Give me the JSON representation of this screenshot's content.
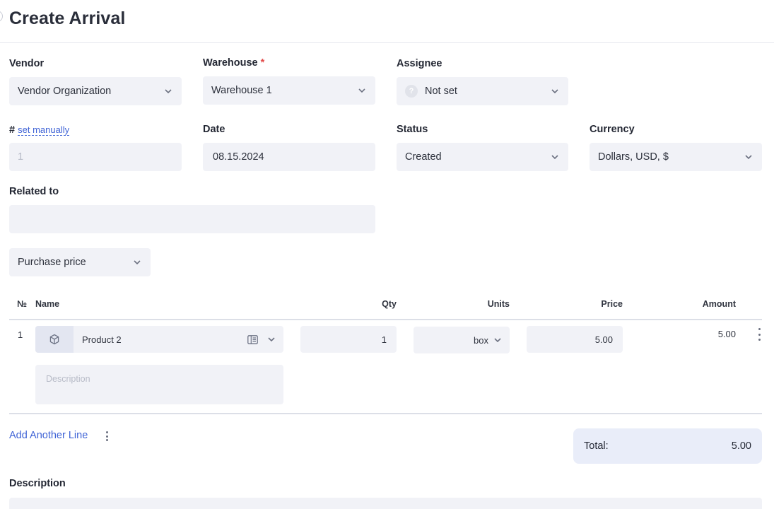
{
  "header": {
    "title": "Create Arrival"
  },
  "vendor": {
    "label": "Vendor",
    "value": "Vendor Organization"
  },
  "warehouse": {
    "label": "Warehouse",
    "required_mark": "*",
    "value": "Warehouse 1"
  },
  "assignee": {
    "label": "Assignee",
    "icon_text": "?",
    "value": "Not set"
  },
  "number": {
    "label": "#",
    "set_manually": "set manually",
    "value": "1"
  },
  "date": {
    "label": "Date",
    "value": "08.15.2024"
  },
  "status": {
    "label": "Status",
    "value": "Created"
  },
  "currency": {
    "label": "Currency",
    "value": "Dollars, USD, $"
  },
  "related": {
    "label": "Related to",
    "value": ""
  },
  "price_type": {
    "value": "Purchase price"
  },
  "table": {
    "columns": {
      "no": "№",
      "name": "Name",
      "qty": "Qty",
      "units": "Units",
      "price": "Price",
      "amount": "Amount"
    },
    "rows": [
      {
        "no": "1",
        "product": "Product 2",
        "qty": "1",
        "units": "box",
        "price": "5.00",
        "amount": "5.00",
        "description_placeholder": "Description"
      }
    ]
  },
  "add_line": "Add Another Line",
  "total": {
    "label": "Total:",
    "value": "5.00"
  },
  "description_section": {
    "label": "Description"
  },
  "icons": [
    "chevron-down-icon",
    "question-icon",
    "box-icon",
    "catalog-icon",
    "kebab-icon"
  ]
}
